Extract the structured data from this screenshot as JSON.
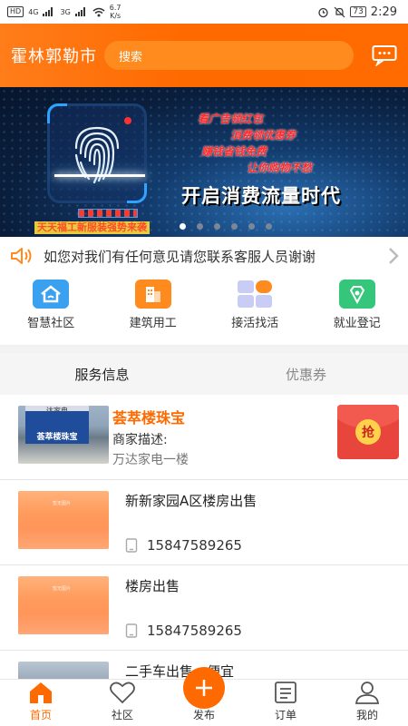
{
  "status": {
    "left_chip": "HD",
    "net1": "4G",
    "net2": "3G",
    "speed_value": "6.7",
    "speed_unit": "K/s",
    "battery": "73",
    "time": "2:29"
  },
  "header": {
    "city": "霍林郭勒市",
    "search_placeholder": "搜索"
  },
  "banner": {
    "lines": [
      "看广告领红包",
      "消费领优惠券",
      "赚钱省钱免费",
      "让你购物不愁"
    ],
    "headline": "开启消费流量时代",
    "bottom_line": "天天福工新服装强势来袭",
    "dots": 6,
    "active_dot": 0
  },
  "notice": {
    "text": "如您对我们有任何意见请您联系客服人员谢谢"
  },
  "quick_entries": [
    {
      "label": "智慧社区",
      "color": "#3aa0f0",
      "icon": "home-community-icon"
    },
    {
      "label": "建筑用工",
      "color": "#ff8a1e",
      "icon": "building-icon"
    },
    {
      "label": "接活找活",
      "color": "#a8b4f0",
      "icon": "grid-apps-icon"
    },
    {
      "label": "就业登记",
      "color": "#35c67b",
      "icon": "register-icon"
    }
  ],
  "tabs": [
    {
      "label": "服务信息",
      "active": true
    },
    {
      "label": "优惠券",
      "active": false
    }
  ],
  "list": [
    {
      "title": "荟萃楼珠宝",
      "desc": "商家描述:",
      "sub": "万达家电一楼",
      "thumb": "photo",
      "sign_top": "达家电",
      "sign_main": "荟萃楼珠宝",
      "redpack": "抢"
    },
    {
      "title": "新新家园A区楼房出售",
      "phone": "15847589265",
      "thumb": "orange",
      "placeholder": "暂无图片"
    },
    {
      "title": "楼房出售",
      "phone": "15847589265",
      "thumb": "orange",
      "placeholder": "暂无图片"
    },
    {
      "title": "二手车出售一便宜",
      "thumb": "car"
    }
  ],
  "bottom_nav": [
    {
      "label": "首页",
      "active": true
    },
    {
      "label": "社区",
      "active": false
    },
    {
      "label": "发布",
      "active": false
    },
    {
      "label": "订单",
      "active": false
    },
    {
      "label": "我的",
      "active": false
    }
  ],
  "colors": {
    "brand": "#ff6a00",
    "header_bg": "#ff7d1a",
    "tab_bg": "#f5f5f5"
  }
}
